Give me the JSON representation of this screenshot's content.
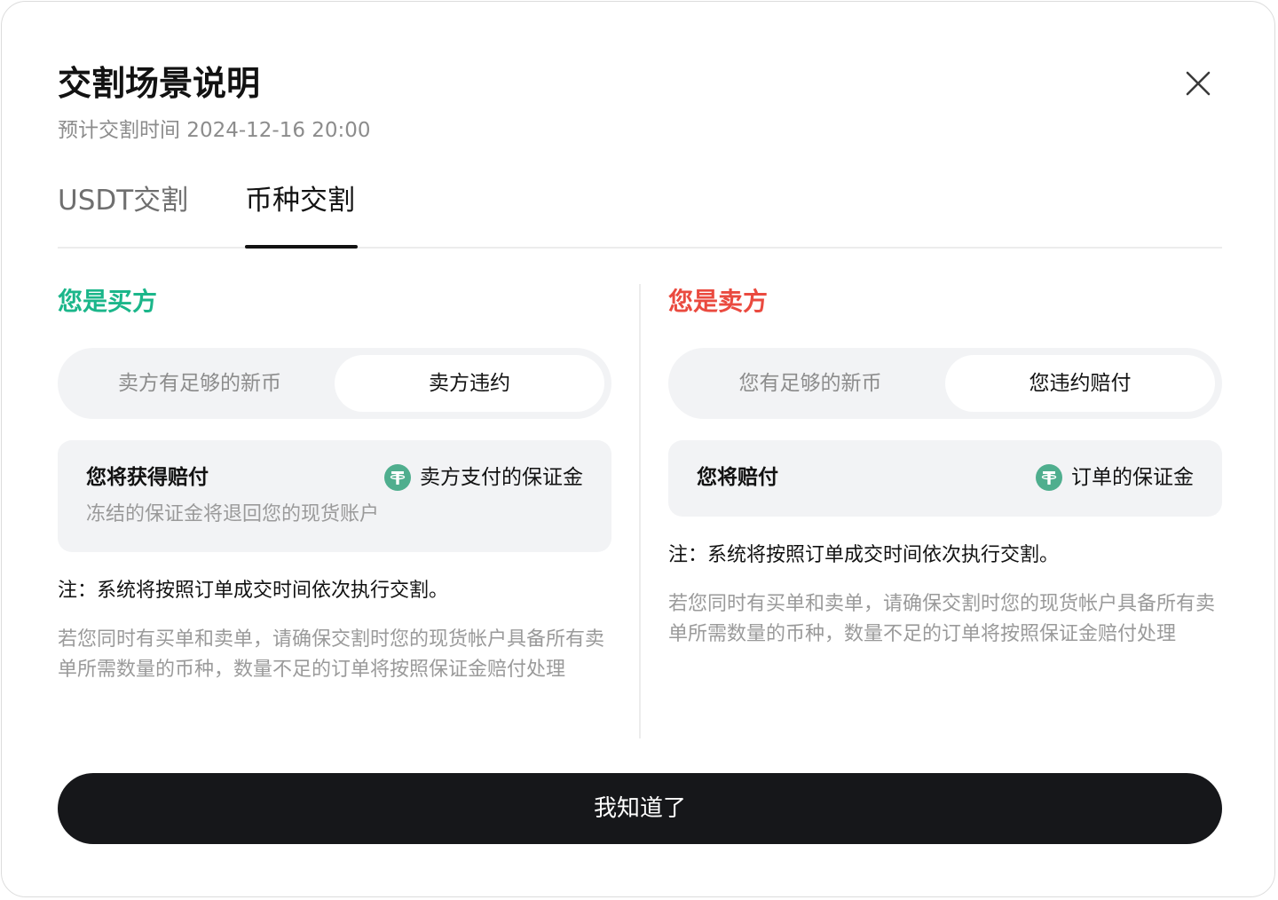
{
  "modal": {
    "title": "交割场景说明",
    "subtitle": "预计交割时间 2024-12-16 20:00",
    "close_icon": "close-icon"
  },
  "tabs": [
    {
      "label": "USDT交割",
      "active": false
    },
    {
      "label": "币种交割",
      "active": true
    }
  ],
  "buyer": {
    "title": "您是买方",
    "title_color": "#1bb68a",
    "segments": [
      {
        "label": "卖方有足够的新币",
        "selected": false
      },
      {
        "label": "卖方违约",
        "selected": true
      }
    ],
    "info": {
      "label": "您将获得赔付",
      "value_icon": "usdt-icon",
      "value": "卖方支付的保证金",
      "desc": "冻结的保证金将退回您的现货账户"
    },
    "note": "注：系统将按照订单成交时间依次执行交割。",
    "note_sub": "若您同时有买单和卖单，请确保交割时您的现货帐户具备所有卖单所需数量的币种，数量不足的订单将按照保证金赔付处理"
  },
  "seller": {
    "title": "您是卖方",
    "title_color": "#ea4a3f",
    "segments": [
      {
        "label": "您有足够的新币",
        "selected": false
      },
      {
        "label": "您违约赔付",
        "selected": true
      }
    ],
    "info": {
      "label": "您将赔付",
      "value_icon": "usdt-icon",
      "value": "订单的保证金"
    },
    "note": "注：系统将按照订单成交时间依次执行交割。",
    "note_sub": "若您同时有买单和卖单，请确保交割时您的现货帐户具备所有卖单所需数量的币种，数量不足的订单将按照保证金赔付处理"
  },
  "confirm_button": "我知道了",
  "colors": {
    "usdt_green": "#4fae8e",
    "button_bg": "#16171a"
  }
}
